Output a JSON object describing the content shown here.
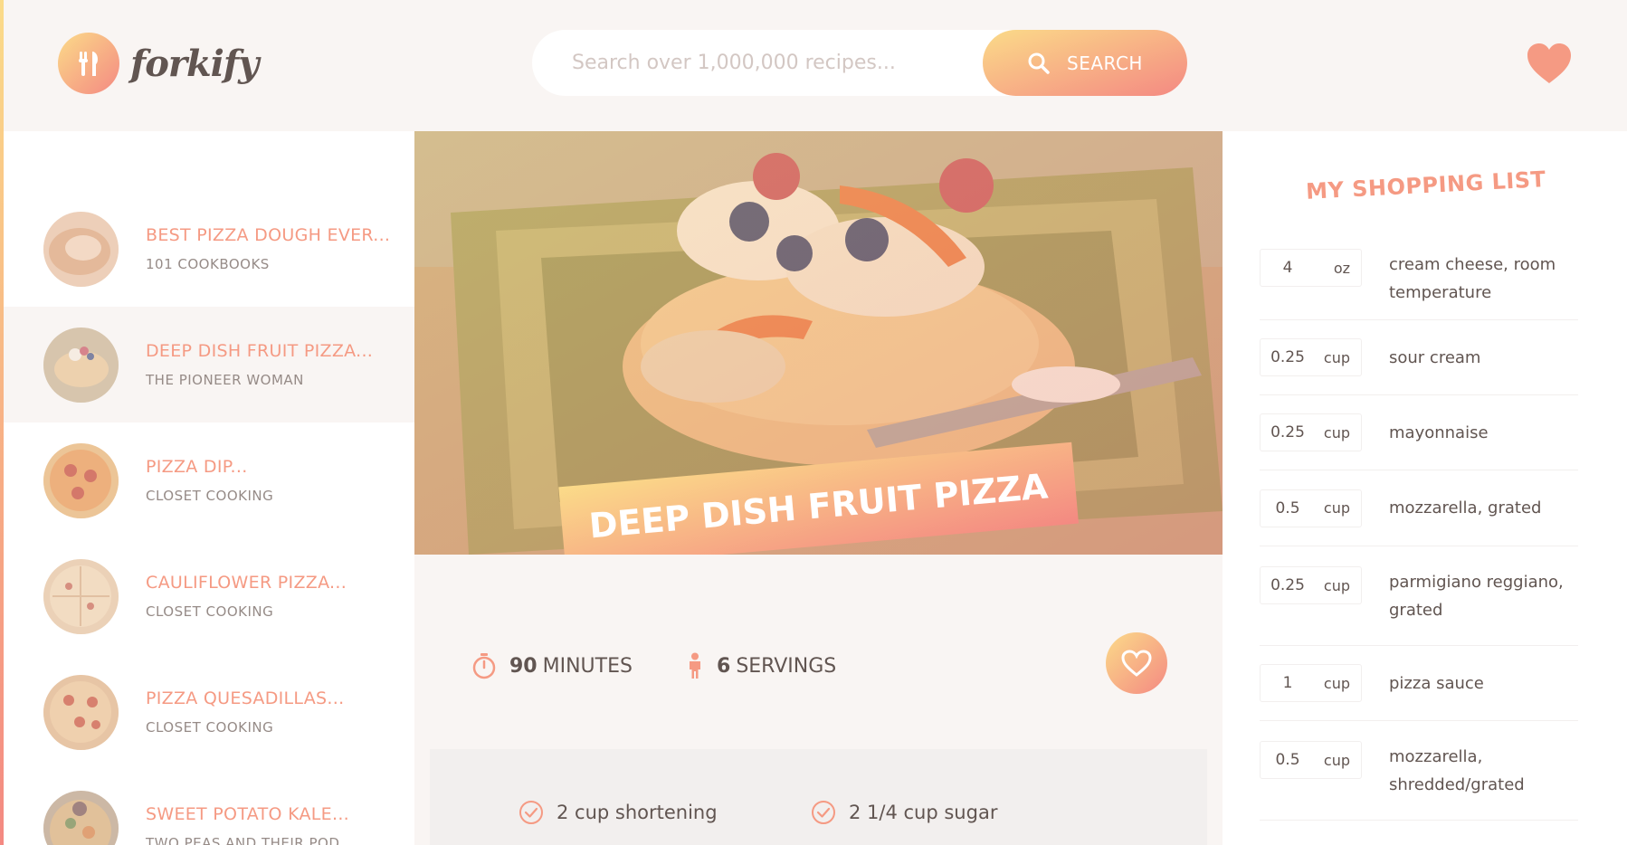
{
  "colors": {
    "accent_start": "#fbdb89",
    "accent_end": "#f48982",
    "title_color": "#f59a83"
  },
  "brand": {
    "name": "forkify"
  },
  "search": {
    "placeholder": "Search over 1,000,000 recipes...",
    "button_label": "SEARCH"
  },
  "results": [
    {
      "title": "BEST PIZZA DOUGH EVER...",
      "publisher": "101 COOKBOOKS",
      "active": false
    },
    {
      "title": "DEEP DISH FRUIT PIZZA...",
      "publisher": "THE PIONEER WOMAN",
      "active": true
    },
    {
      "title": "PIZZA DIP...",
      "publisher": "CLOSET COOKING",
      "active": false
    },
    {
      "title": "CAULIFLOWER PIZZA...",
      "publisher": "CLOSET COOKING",
      "active": false
    },
    {
      "title": "PIZZA QUESADILLAS...",
      "publisher": "CLOSET COOKING",
      "active": false
    },
    {
      "title": "SWEET POTATO KALE...",
      "publisher": "TWO PEAS AND THEIR POD",
      "active": false
    }
  ],
  "recipe": {
    "title": "DEEP DISH FRUIT PIZZA",
    "minutes": "90",
    "minutes_label": "MINUTES",
    "servings": "6",
    "servings_label": "SERVINGS",
    "ingredients": [
      "2 cup shortening",
      "2 1/4 cup sugar"
    ]
  },
  "shopping": {
    "title": "MY SHOPPING LIST",
    "items": [
      {
        "count": "4",
        "unit": "oz",
        "desc": "cream cheese, room temperature"
      },
      {
        "count": "0.25",
        "unit": "cup",
        "desc": "sour cream"
      },
      {
        "count": "0.25",
        "unit": "cup",
        "desc": "mayonnaise"
      },
      {
        "count": "0.5",
        "unit": "cup",
        "desc": "mozzarella, grated"
      },
      {
        "count": "0.25",
        "unit": "cup",
        "desc": "parmigiano reggiano, grated"
      },
      {
        "count": "1",
        "unit": "cup",
        "desc": "pizza sauce"
      },
      {
        "count": "0.5",
        "unit": "cup",
        "desc": "mozzarella, shredded/grated"
      }
    ]
  }
}
